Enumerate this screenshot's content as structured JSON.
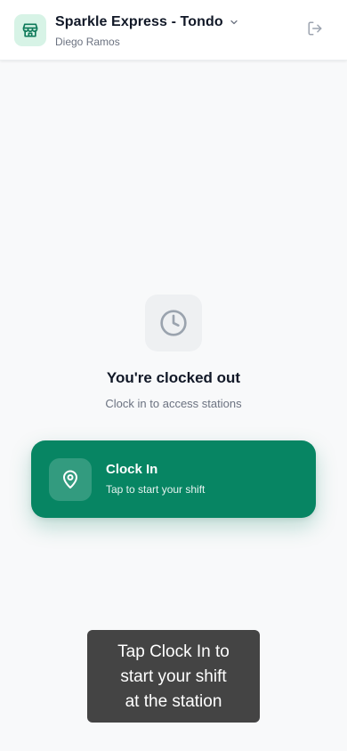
{
  "header": {
    "store_name": "Sparkle Express - Tondo",
    "user_name": "Diego Ramos",
    "icons": {
      "store": "store-icon",
      "dropdown": "chevron-down-icon",
      "logout": "logout-icon"
    }
  },
  "status": {
    "icon": "clock-icon",
    "title": "You're clocked out",
    "subtitle": "Clock in to access stations"
  },
  "clock_in": {
    "icon": "location-pin-icon",
    "title": "Clock In",
    "subtitle": "Tap to start your shift"
  },
  "tooltip": {
    "line1": "Tap Clock In to",
    "line2": "start your shift",
    "line3": "at the station"
  },
  "colors": {
    "accent": "#078563",
    "accent_light": "#d7f3e6",
    "background": "#f8f9fa",
    "tooltip_bg": "#343434"
  }
}
